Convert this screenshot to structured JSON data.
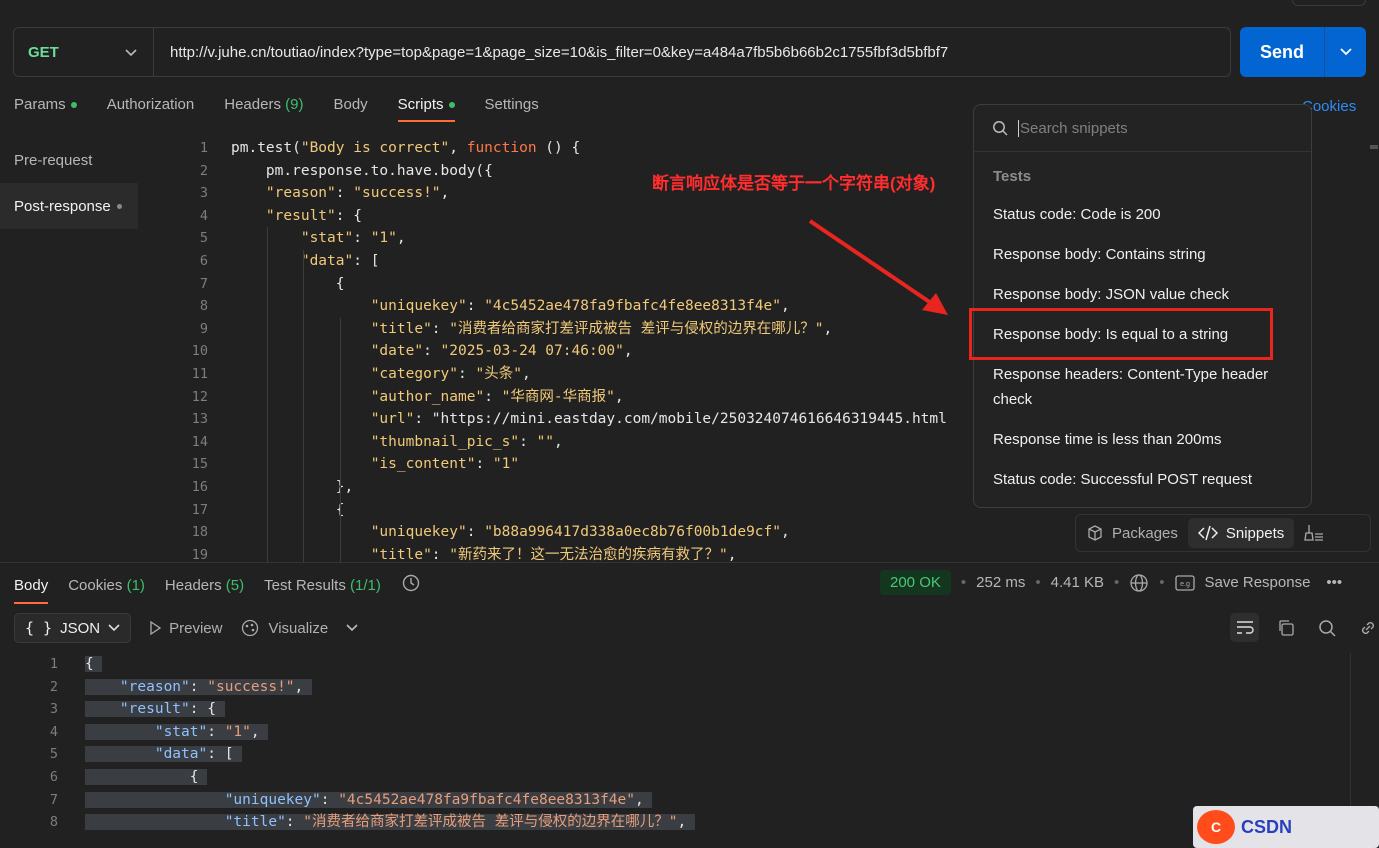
{
  "request": {
    "method": "GET",
    "url": "http://v.juhe.cn/toutiao/index?type=top&page=1&page_size=10&is_filter=0&key=a484a7fb5b6b66b2c1755fbf3d5bfbf7",
    "send_label": "Send"
  },
  "request_tabs": [
    {
      "label": "Params"
    },
    {
      "label": "Authorization"
    },
    {
      "label": "Headers",
      "count": "(9)"
    },
    {
      "label": "Body"
    },
    {
      "label": "Scripts"
    },
    {
      "label": "Settings"
    }
  ],
  "cookies_link": "Cookies",
  "script_nav": [
    "Pre-request",
    "Post-response"
  ],
  "editor_lines": [
    {
      "n": "1",
      "code": "pm.test(\"Body is correct\", function () {"
    },
    {
      "n": "2",
      "code": "    pm.response.to.have.body({"
    },
    {
      "n": "3",
      "code": "    \"reason\": \"success!\","
    },
    {
      "n": "4",
      "code": "    \"result\": {"
    },
    {
      "n": "5",
      "code": "        \"stat\": \"1\","
    },
    {
      "n": "6",
      "code": "        \"data\": ["
    },
    {
      "n": "7",
      "code": "            {"
    },
    {
      "n": "8",
      "code": "                \"uniquekey\": \"4c5452ae478fa9fbafc4fe8ee8313f4e\","
    },
    {
      "n": "9",
      "code": "                \"title\": \"消费者给商家打差评成被告 差评与侵权的边界在哪儿？\","
    },
    {
      "n": "10",
      "code": "                \"date\": \"2025-03-24 07:46:00\","
    },
    {
      "n": "11",
      "code": "                \"category\": \"头条\","
    },
    {
      "n": "12",
      "code": "                \"author_name\": \"华商网-华商报\","
    },
    {
      "n": "13",
      "code": "                \"url\": \"https://mini.eastday.com/mobile/250324074616646319445.html"
    },
    {
      "n": "14",
      "code": "                \"thumbnail_pic_s\": \"\","
    },
    {
      "n": "15",
      "code": "                \"is_content\": \"1\""
    },
    {
      "n": "16",
      "code": "            },"
    },
    {
      "n": "17",
      "code": "            {"
    },
    {
      "n": "18",
      "code": "                \"uniquekey\": \"b88a996417d338a0ec8b76f00b1de9cf\","
    },
    {
      "n": "19",
      "code": "                \"title\": \"新药来了！这一无法治愈的疾病有救了？\","
    }
  ],
  "annotation": "断言响应体是否等于一个字符串(对象)",
  "snippets": {
    "search_placeholder": "Search snippets",
    "section": "Tests",
    "items": [
      "Status code: Code is 200",
      "Response body: Contains string",
      "Response body: JSON value check",
      "Response body: Is equal to a string",
      "Response headers: Content-Type header check",
      "Response time is less than 200ms",
      "Status code: Successful POST request"
    ]
  },
  "floatbar": {
    "packages": "Packages",
    "snippets": "Snippets"
  },
  "response_tabs": [
    {
      "label": "Body",
      "count": ""
    },
    {
      "label": "Cookies",
      "count": "(1)"
    },
    {
      "label": "Headers",
      "count": "(5)"
    },
    {
      "label": "Test Results",
      "count": "(1/1)"
    }
  ],
  "response_status": {
    "code": "200 OK",
    "time": "252 ms",
    "size": "4.41 KB",
    "save": "Save Response"
  },
  "view": {
    "format": "JSON",
    "preview": "Preview",
    "visualize": "Visualize"
  },
  "response_lines": [
    {
      "n": "1",
      "indent": "",
      "parts": [
        [
          "p",
          "{"
        ]
      ]
    },
    {
      "n": "2",
      "indent": "    ",
      "parts": [
        [
          "k",
          "\"reason\""
        ],
        [
          "p",
          ": "
        ],
        [
          "s",
          "\"success!\""
        ],
        [
          "p",
          ","
        ]
      ]
    },
    {
      "n": "3",
      "indent": "    ",
      "parts": [
        [
          "k",
          "\"result\""
        ],
        [
          "p",
          ": {"
        ]
      ]
    },
    {
      "n": "4",
      "indent": "        ",
      "parts": [
        [
          "k",
          "\"stat\""
        ],
        [
          "p",
          ": "
        ],
        [
          "s",
          "\"1\""
        ],
        [
          "p",
          ","
        ]
      ]
    },
    {
      "n": "5",
      "indent": "        ",
      "parts": [
        [
          "k",
          "\"data\""
        ],
        [
          "p",
          ": ["
        ]
      ]
    },
    {
      "n": "6",
      "indent": "            ",
      "parts": [
        [
          "p",
          "{"
        ]
      ]
    },
    {
      "n": "7",
      "indent": "                ",
      "parts": [
        [
          "k",
          "\"uniquekey\""
        ],
        [
          "p",
          ": "
        ],
        [
          "s",
          "\"4c5452ae478fa9fbafc4fe8ee8313f4e\""
        ],
        [
          "p",
          ","
        ]
      ]
    },
    {
      "n": "8",
      "indent": "                ",
      "parts": [
        [
          "k",
          "\"title\""
        ],
        [
          "p",
          ": "
        ],
        [
          "s",
          "\"消费者给商家打差评成被告 差评与侵权的边界在哪儿？\""
        ],
        [
          "p",
          ","
        ]
      ]
    }
  ],
  "watermark": "CSDN"
}
